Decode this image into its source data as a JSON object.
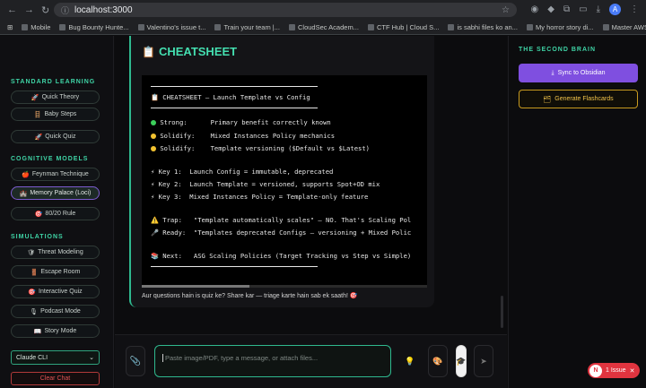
{
  "browser": {
    "url": "localhost:3000",
    "bookmarks": [
      "Mobile",
      "Bug Bounty Hunte...",
      "Valentino's issue t...",
      "Train your team |...",
      "CloudSec Academ...",
      "CTF Hub | Cloud S...",
      "is sabhi files ko an...",
      "My horror story di...",
      "Master AWS Secur..."
    ],
    "profile_initial": "A"
  },
  "sidebar": {
    "standard_title": "STANDARD LEARNING",
    "standard_items": [
      {
        "icon": "🚀",
        "label": "Quick Theory"
      },
      {
        "icon": "🪜",
        "label": "Baby Steps"
      },
      {
        "icon": "🚀",
        "label": "Quick Quiz"
      }
    ],
    "cognitive_title": "COGNITIVE MODELS",
    "cognitive_items": [
      {
        "icon": "🍎",
        "label": "Feynman Technique"
      },
      {
        "icon": "🏰",
        "label": "Memory Palace (Loci)"
      },
      {
        "icon": "🎯",
        "label": "80/20 Rule"
      }
    ],
    "simulations_title": "SIMULATIONS",
    "simulation_items": [
      {
        "icon": "🛡",
        "label": "Threat Modeling"
      },
      {
        "icon": "🚪",
        "label": "Escape Room"
      },
      {
        "icon": "🎯",
        "label": "Interactive Quiz"
      },
      {
        "icon": "🎙",
        "label": "Podcast Mode"
      },
      {
        "icon": "📖",
        "label": "Story Mode"
      }
    ],
    "model_select": "Claude CLI",
    "clear_label": "Clear Chat"
  },
  "card": {
    "title": "CHEATSHEET",
    "lines": {
      "header": "📋 CHEATSHEET — Launch Template vs Config",
      "strong": "Strong:      Primary benefit correctly known",
      "solidify1": "Solidify:    Mixed Instances Policy mechanics",
      "solidify2": "Solidify:    Template versioning ($Default vs $Latest)",
      "key1": "⚡ Key 1:  Launch Config = immutable, deprecated",
      "key2": "⚡ Key 2:  Launch Template = versioned, supports Spot+OD mix",
      "key3": "⚡ Key 3:  Mixed Instances Policy = Template-only feature",
      "trap": "⚠️ Trap:   \"Template automatically scales\" — NO. That's Scaling Pol",
      "ready": "🎤 Ready:  \"Templates deprecated Configs — versioning + Mixed Polic",
      "next": "📚 Next:   ASG Scaling Policies (Target Tracking vs Step vs Simple)"
    },
    "footer": "Aur questions hain is quiz ke? Share kar — triage karte hain sab ek saath! 🎯"
  },
  "composer": {
    "placeholder": "Paste image/PDF, type a message, or attach files..."
  },
  "right": {
    "title": "THE SECOND BRAIN",
    "sync_label": "Sync to Obsidian",
    "flash_label": "Generate Flashcards"
  },
  "issues": {
    "label": "1 Issue"
  },
  "colors": {
    "accent": "#3fd4a6",
    "purple": "#7f4fe0",
    "gold": "#c89a1f",
    "danger": "#e0343f"
  }
}
